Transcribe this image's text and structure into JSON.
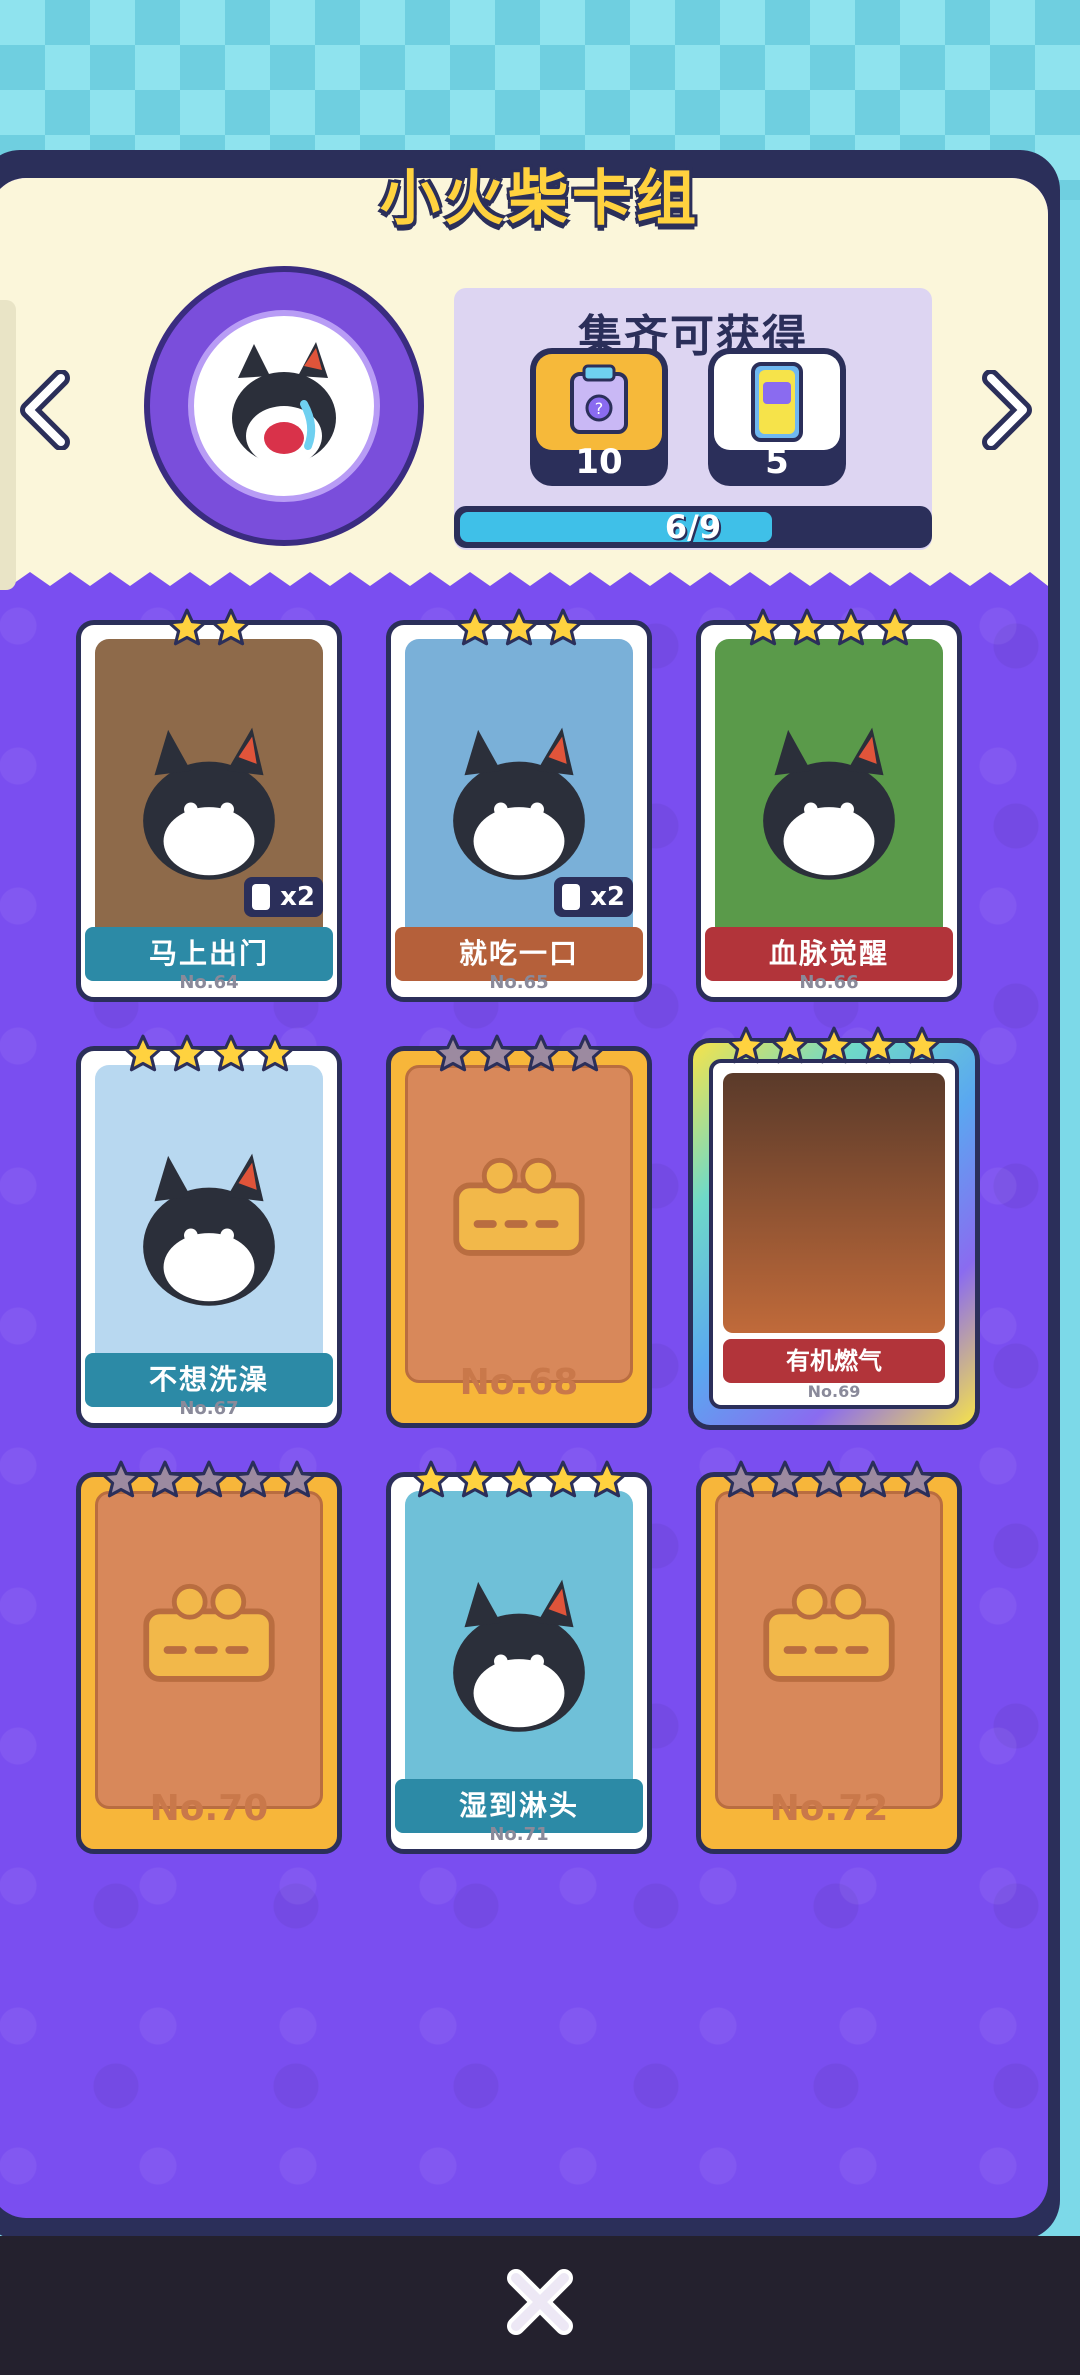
{
  "header": {
    "title": "小火柴卡组"
  },
  "reward": {
    "title": "集齐可获得",
    "items": [
      {
        "icon": "mystery-box-icon",
        "count": "10"
      },
      {
        "icon": "card-pack-icon",
        "count": "5"
      }
    ],
    "progress_text": "6/9",
    "progress_value": 0.67
  },
  "cards": [
    {
      "name": "马上出门",
      "number": "No.64",
      "stars": 2,
      "duplicate": "x2",
      "collected": true,
      "banner_color": "#2C8AA6"
    },
    {
      "name": "就吃一口",
      "number": "No.65",
      "stars": 3,
      "duplicate": "x2",
      "collected": true,
      "banner_color": "#B5603A"
    },
    {
      "name": "血脉觉醒",
      "number": "No.66",
      "stars": 4,
      "duplicate": "",
      "collected": true,
      "banner_color": "#B2343A"
    },
    {
      "name": "不想洗澡",
      "number": "No.67",
      "stars": 4,
      "duplicate": "",
      "collected": true,
      "banner_color": "#2C8AA6"
    },
    {
      "name": "",
      "number": "No.68",
      "stars": 4,
      "duplicate": "",
      "collected": false
    },
    {
      "name": "有机燃气",
      "number": "No.69",
      "stars": 5,
      "duplicate": "",
      "collected": true,
      "banner_color": "#B2343A"
    },
    {
      "name": "",
      "number": "No.70",
      "stars": 5,
      "duplicate": "",
      "collected": false
    },
    {
      "name": "湿到淋头",
      "number": "No.71",
      "stars": 5,
      "duplicate": "",
      "collected": true,
      "banner_color": "#2C8AA6"
    },
    {
      "name": "",
      "number": "No.72",
      "stars": 5,
      "duplicate": "",
      "collected": false
    }
  ],
  "colors": {
    "gold_star": "#FFD23F",
    "grey_star": "#9C8AA0",
    "panel": "#7A4EF0"
  }
}
